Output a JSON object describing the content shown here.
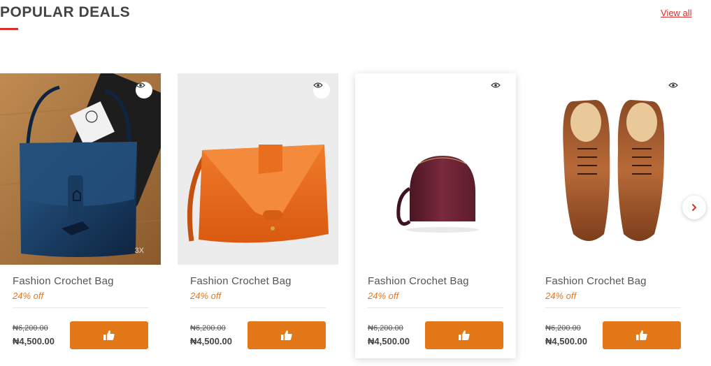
{
  "header": {
    "title": "POPULAR DEALS",
    "view_all": "View all"
  },
  "colors": {
    "accent": "#d9302c",
    "button": "#e27817",
    "discount_text": "#e27817"
  },
  "icons": {
    "quick_view": "eye-icon",
    "like": "thumbs-up-icon",
    "next": "chevron-right-icon"
  },
  "products": [
    {
      "name": "Fashion Crochet Bag",
      "discount": "24% off",
      "old_price": "₦6,200.00",
      "price": "₦4,500.00",
      "zoom_label": "3X"
    },
    {
      "name": "Fashion Crochet Bag",
      "discount": "24% off",
      "old_price": "₦6,200.00",
      "price": "₦4,500.00"
    },
    {
      "name": "Fashion Crochet Bag",
      "discount": "24% off",
      "old_price": "₦6,200.00",
      "price": "₦4,500.00"
    },
    {
      "name": "Fashion Crochet Bag",
      "discount": "24% off",
      "old_price": "₦6,200.00",
      "price": "₦4,500.00"
    }
  ]
}
